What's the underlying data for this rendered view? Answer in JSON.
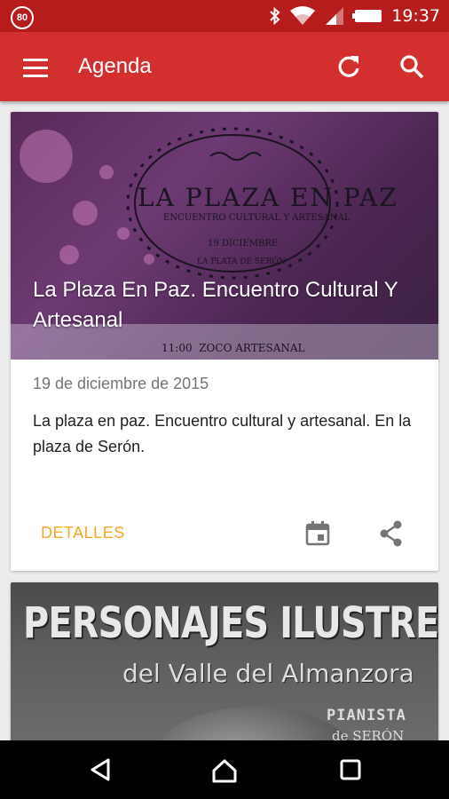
{
  "status_bar": {
    "notification_badge": "80",
    "time": "19:37",
    "icons": [
      "bluetooth-icon",
      "wifi-icon",
      "signal-icon",
      "battery-icon"
    ]
  },
  "app_bar": {
    "title": "Agenda",
    "icons": [
      "menu-icon",
      "refresh-icon",
      "search-icon"
    ]
  },
  "cards": [
    {
      "title": "La Plaza En Paz. Encuentro Cultural Y Artesanal",
      "poster_text": {
        "heading": "LA PLAZA EN PAZ",
        "subheading": "ENCUENTRO CULTURAL Y ARTESANAL",
        "date": "19 DICIEMBRE",
        "place": "LA PLATA DE SERÓN",
        "bottom": "11:00  ZOCO ARTESANAL"
      },
      "date": "19 de diciembre de 2015",
      "description": "La plaza en paz. Encuentro cultural y artesanal. En la plaza de Serón.",
      "action_label": "DETALLES",
      "icons": [
        "calendar-icon",
        "share-icon"
      ]
    },
    {
      "poster_text": {
        "heading": "PERSONAJES ILUSTRES",
        "subheading": "del Valle del Almanzora",
        "tag1": "PIANISTA",
        "tag2": "de SERÓN"
      }
    }
  ],
  "colors": {
    "status_bar": "#b71c1c",
    "app_bar": "#d32f2f",
    "accent": "#f5a623",
    "background": "#ececec"
  },
  "navigation_bar": {
    "icons": [
      "back-icon",
      "home-icon",
      "recent-apps-icon"
    ]
  }
}
